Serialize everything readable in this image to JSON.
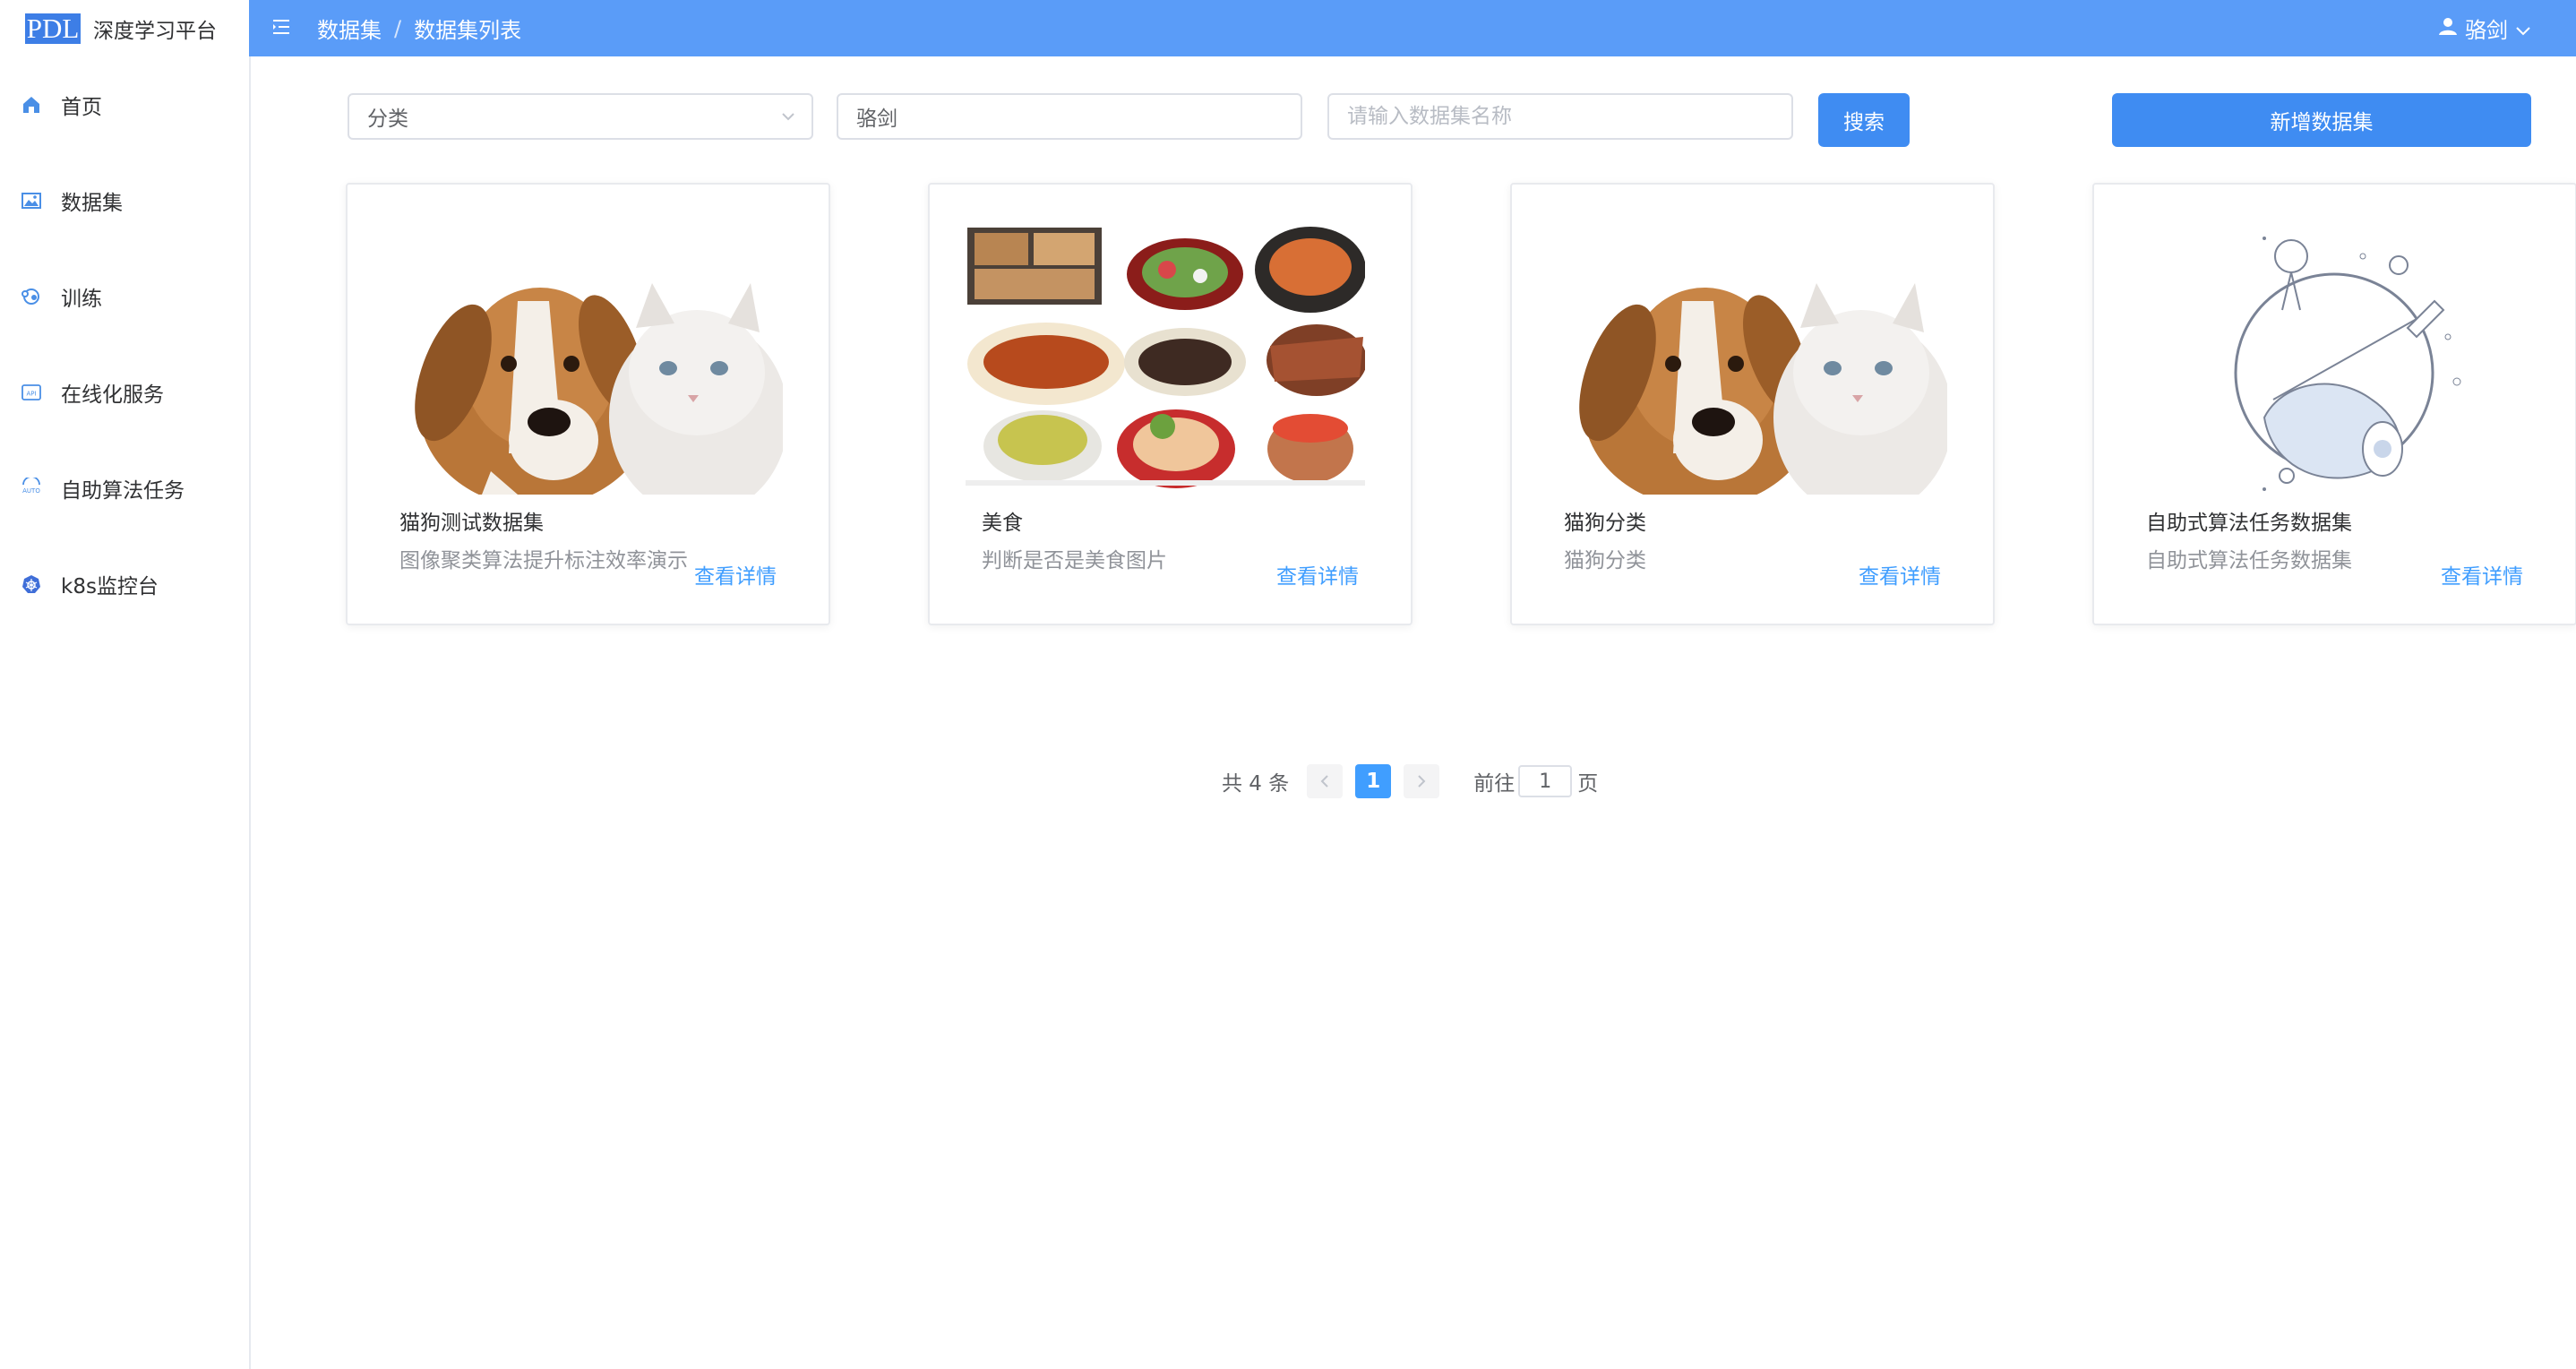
{
  "brand": {
    "logo": "PDL",
    "name": "深度学习平台"
  },
  "sidebar": {
    "items": [
      {
        "label": "首页",
        "icon": "home-icon"
      },
      {
        "label": "数据集",
        "icon": "image-icon"
      },
      {
        "label": "训练",
        "icon": "train-icon"
      },
      {
        "label": "在线化服务",
        "icon": "api-icon"
      },
      {
        "label": "自助算法任务",
        "icon": "auto-icon"
      },
      {
        "label": "k8s监控台",
        "icon": "kubernetes-icon"
      }
    ]
  },
  "header": {
    "breadcrumb": [
      "数据集",
      "数据集列表"
    ],
    "user": "骆剑",
    "background": "#5a9cf8"
  },
  "filters": {
    "category_value": "分类",
    "creator_value": "骆剑",
    "name_placeholder": "请输入数据集名称",
    "search_label": "搜索",
    "add_label": "新增数据集"
  },
  "cards": [
    {
      "title": "猫狗测试数据集",
      "desc": "图像聚类算法提升标注效率演示",
      "link": "查看详情",
      "image": "dog-and-cat"
    },
    {
      "title": "美食",
      "desc": "判断是否是美食图片",
      "link": "查看详情",
      "image": "food-collage"
    },
    {
      "title": "猫狗分类",
      "desc": "猫狗分类",
      "link": "查看详情",
      "image": "dog-and-cat"
    },
    {
      "title": "自助式算法任务数据集",
      "desc": "自助式算法任务数据集",
      "link": "查看详情",
      "image": "space-illustration"
    }
  ],
  "pagination": {
    "total_label": "共 4 条",
    "current_page": "1",
    "goto_label": "前往",
    "goto_value": "1",
    "page_suffix": "页"
  },
  "colors": {
    "accent": "#409eff",
    "primary_button": "#3f8cf2"
  }
}
